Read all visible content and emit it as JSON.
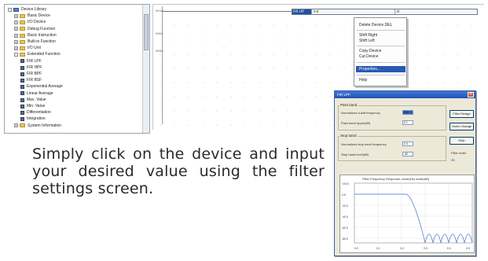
{
  "tree": {
    "items": [
      {
        "label": "Device Library",
        "level": 0,
        "kind": "root",
        "expander": "-"
      },
      {
        "label": "Basic Device",
        "level": 1,
        "kind": "folder",
        "expander": "+"
      },
      {
        "label": "I/O Device",
        "level": 1,
        "kind": "folder",
        "expander": "+"
      },
      {
        "label": "Debug Function",
        "level": 1,
        "kind": "folder",
        "expander": "+"
      },
      {
        "label": "Basic Instruction",
        "level": 1,
        "kind": "folder",
        "expander": "+"
      },
      {
        "label": "Built-in Function",
        "level": 1,
        "kind": "folder",
        "expander": "+"
      },
      {
        "label": "I/O Unit",
        "level": 1,
        "kind": "folder",
        "expander": "+"
      },
      {
        "label": "Extended Function",
        "level": 1,
        "kind": "folder",
        "expander": "-"
      },
      {
        "label": "FIR LPF",
        "level": 2,
        "kind": "function",
        "expander": ""
      },
      {
        "label": "FIR HPF",
        "level": 2,
        "kind": "function",
        "expander": ""
      },
      {
        "label": "FIR BPF",
        "level": 2,
        "kind": "function",
        "expander": ""
      },
      {
        "label": "FIR BSF",
        "level": 2,
        "kind": "function",
        "expander": ""
      },
      {
        "label": "Exponential Average",
        "level": 2,
        "kind": "function",
        "expander": ""
      },
      {
        "label": "Linear Average",
        "level": 2,
        "kind": "function",
        "expander": ""
      },
      {
        "label": "Max. Value",
        "level": 2,
        "kind": "function",
        "expander": ""
      },
      {
        "label": "Min. Value",
        "level": 2,
        "kind": "function",
        "expander": ""
      },
      {
        "label": "Differentiation",
        "level": 2,
        "kind": "function",
        "expander": ""
      },
      {
        "label": "Integration",
        "level": 2,
        "kind": "function",
        "expander": ""
      },
      {
        "label": "System Information",
        "level": 1,
        "kind": "folder",
        "expander": "+"
      }
    ]
  },
  "canvas": {
    "row_numbers": [
      "0010",
      "0050",
      "0090"
    ],
    "device": {
      "name": "FIR LPF",
      "cells": [
        "Ind",
        "Id"
      ]
    }
  },
  "context_menu": {
    "items": [
      "Delete Device   DEL",
      "Shift Right",
      "Shift Left",
      "Copy Device",
      "Cut Device",
      "Properties...",
      "Help"
    ],
    "selected": "Properties..."
  },
  "caption": "Simply click on the device and input your desired value using the filter settings screen.",
  "dialog": {
    "title": "FIR LPF",
    "close_glyph": "×",
    "pass_band": {
      "group_label": "Pass band",
      "cutoff_label": "Normalized cutoff frequency",
      "cutoff_value": "0.2",
      "ripple_label": "Pass band ripple(dB)",
      "ripple_value": "0.1"
    },
    "stop_band": {
      "group_label": "Stop band",
      "freq_label": "Normalized stop band frequency",
      "freq_value": "0.3",
      "level_label": "Stop band level(dB)",
      "level_value": "-50"
    },
    "buttons": [
      "Filter Design",
      "Order Change",
      "Help"
    ],
    "filter_order_label": "Filter order",
    "filter_order_value": "25",
    "graph": {
      "title": "Filter Frequency Response; scale(Hz) scale(dB)",
      "y_ticks": [
        "+20.0",
        "0.0",
        "-20.0",
        "-40.0",
        "-60.0",
        "-80.0"
      ],
      "x_ticks": [
        "0.0",
        "0.1",
        "0.2",
        "0.3",
        "0.4",
        "0.5"
      ],
      "line_color": "#6d8fd3"
    }
  }
}
